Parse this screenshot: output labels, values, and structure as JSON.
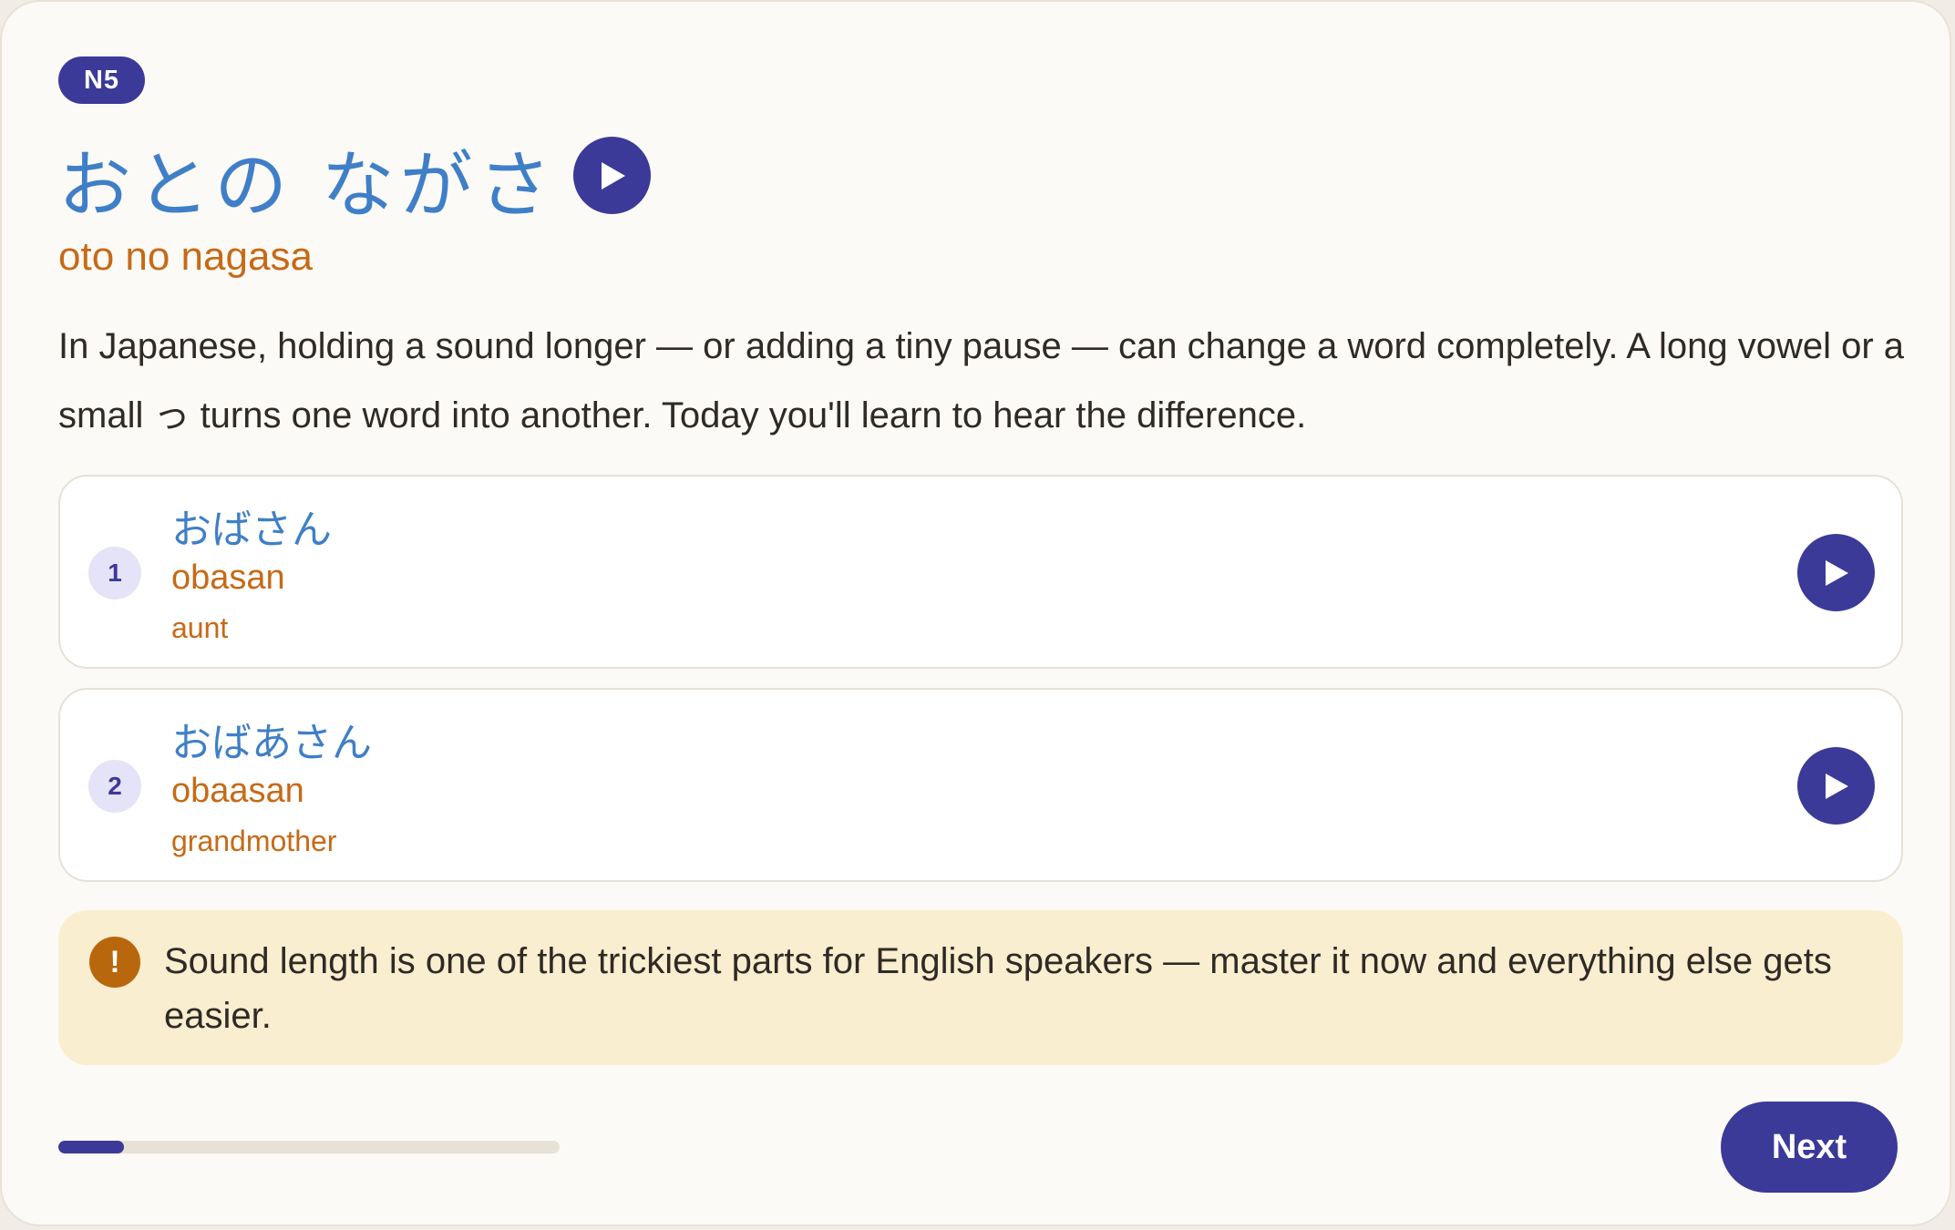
{
  "lesson": {
    "level_badge": "N5",
    "title": "おとの ながさ",
    "title_romaji": "oto no nagasa",
    "intro": "In Japanese, holding a sound longer — or adding a tiny pause — can change a word completely. A long vowel or a small っ turns one word into another. Today you'll learn to hear the difference.",
    "play_icon": "play-icon"
  },
  "words": [
    {
      "number": "1",
      "kana": "おばさん",
      "romaji": "obasan",
      "meaning": "aunt"
    },
    {
      "number": "2",
      "kana": "おばあさん",
      "romaji": "obaasan",
      "meaning": "grandmother"
    }
  ],
  "tip": {
    "icon": "!",
    "text": "Sound length is one of the trickiest parts for English speakers — master it now and everything else gets easier."
  },
  "progress": {
    "fraction": 0.13
  },
  "footer": {
    "next_label": "Next"
  },
  "colors": {
    "accent": "#3b3a98",
    "kana": "#3f7fc7",
    "romaji": "#c66a17",
    "tip_bg": "#faeed0",
    "tip_icon": "#b8670c"
  }
}
